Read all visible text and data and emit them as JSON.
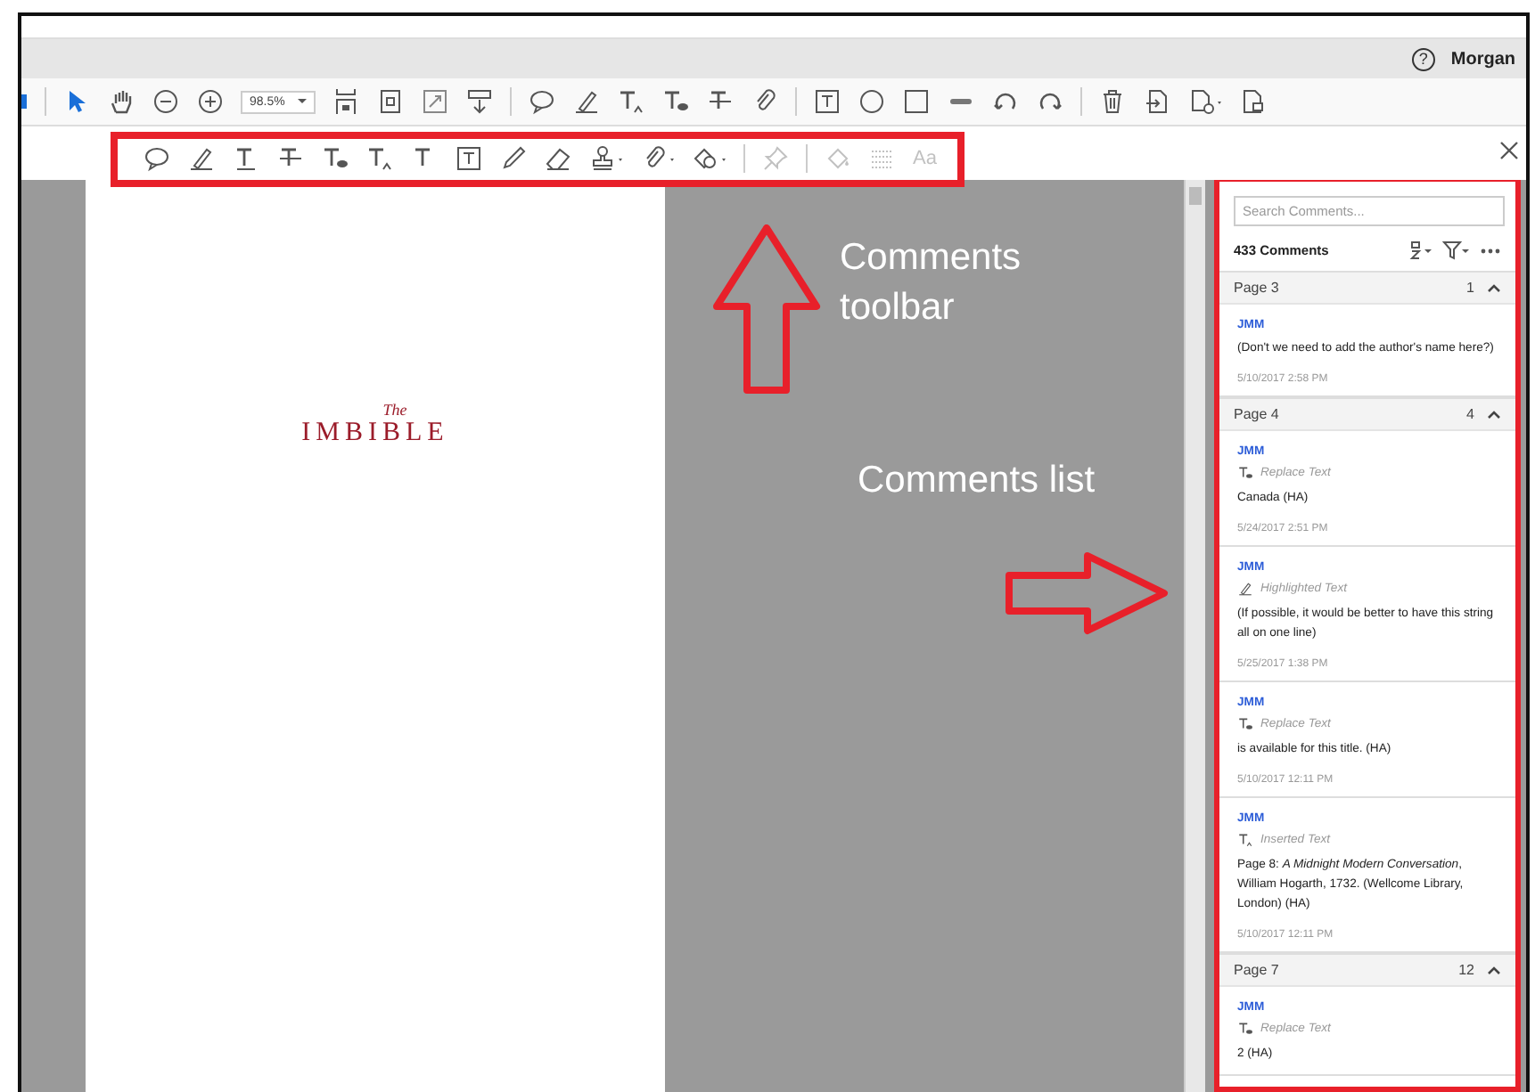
{
  "header": {
    "help": "?",
    "user": "Morgan"
  },
  "main_toolbar": {
    "zoom": "98.5%"
  },
  "comments_toolbar": {
    "style_tools_disabled": true,
    "text_style": "Aa"
  },
  "document": {
    "logo_small": "The",
    "logo": "IMBIBLE"
  },
  "annotations": [
    {
      "kind": "up",
      "label": "Comments toolbar"
    },
    {
      "kind": "right",
      "label": "Comments list"
    }
  ],
  "comments_panel": {
    "search": {
      "placeholder": "Search Comments..."
    },
    "count": "433 Comments",
    "groups": [
      {
        "page": "Page 3",
        "count": "1",
        "expanded": true,
        "comments": [
          {
            "author": "JMM",
            "text": "(Don't we need to add the author's name here?)",
            "date": "5/10/2017  2:58 PM"
          }
        ]
      },
      {
        "page": "Page 4",
        "count": "4",
        "expanded": true,
        "comments": [
          {
            "author": "JMM",
            "kind": "replace",
            "type": "Replace Text",
            "text": "Canada (HA)",
            "date": "5/24/2017  2:51 PM"
          },
          {
            "author": "JMM",
            "kind": "highlight",
            "type": "Highlighted Text",
            "text": "(If possible, it would be better to have this string all on one line)",
            "date": "5/25/2017  1:38 PM"
          },
          {
            "author": "JMM",
            "kind": "replace",
            "type": "Replace Text",
            "text": "is available for this title. (HA)",
            "date": "5/10/2017  12:11 PM"
          },
          {
            "author": "JMM",
            "kind": "insert",
            "type": "Inserted Text",
            "text": "Page 8: *A Midnight Modern Conversation*, William Hogarth, 1732. (Wellcome Library, London) (HA)",
            "date": "5/10/2017  12:11 PM"
          }
        ]
      },
      {
        "page": "Page 7",
        "count": "12",
        "expanded": true,
        "comments": [
          {
            "author": "JMM",
            "kind": "replace",
            "type": "Replace Text",
            "text": "2 (HA)"
          }
        ]
      }
    ]
  }
}
